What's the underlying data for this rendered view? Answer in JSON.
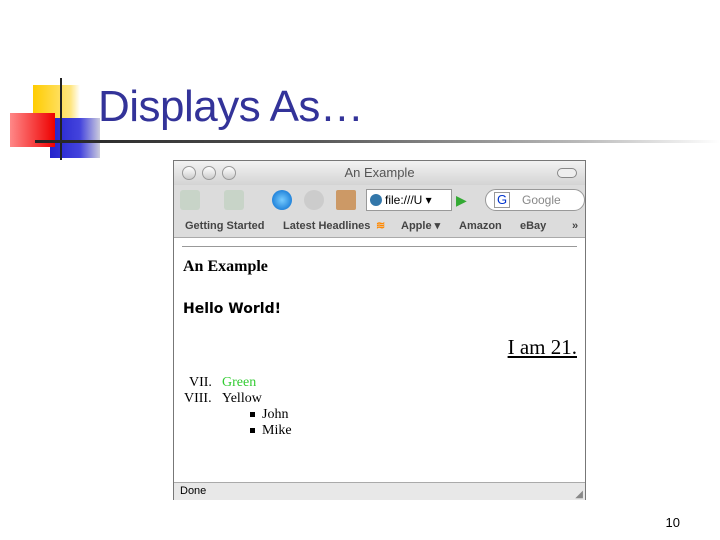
{
  "slide": {
    "title": "Displays As…",
    "page_number": "10"
  },
  "browser": {
    "window_title": "An Example",
    "url": "file:///U",
    "search_placeholder": "Google",
    "bookmarks": [
      "Getting Started",
      "Latest Headlines",
      "Apple ▾",
      "Amazon",
      "eBay",
      "»"
    ],
    "status": "Done",
    "content": {
      "heading": "An Example",
      "subheading": "Hello World!",
      "age_text": "I am 21.",
      "list": [
        {
          "marker": "VII.",
          "text": "Green",
          "color": "#33cc33"
        },
        {
          "marker": "VIII.",
          "text": "Yellow"
        }
      ],
      "sublist": [
        "John",
        "Mike"
      ]
    }
  },
  "colors": {
    "title": "#333399",
    "green": "#33cc33"
  }
}
